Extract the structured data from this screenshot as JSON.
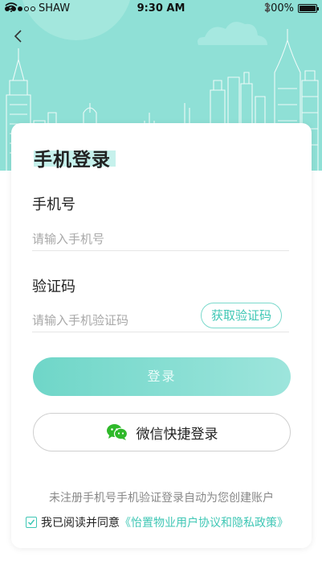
{
  "status_bar": {
    "carrier": "SHAW",
    "time": "9:30 AM",
    "battery": "100%"
  },
  "header": {
    "back_icon": "chevron-left-icon",
    "background_color": "#8fe0d6"
  },
  "form": {
    "title": "手机登录",
    "phone_label": "手机号",
    "phone_placeholder": "请输入手机号",
    "code_label": "验证码",
    "code_placeholder": "请输入手机验证码",
    "get_code_label": "获取验证码"
  },
  "actions": {
    "login_label": "登录",
    "wechat_label": "微信快捷登录",
    "wechat_icon": "wechat-icon"
  },
  "footer": {
    "notice": "未注册手机号手机验证登录自动为您创建账户",
    "agree_prefix": "我已阅读并同意",
    "agree_link": "《怡置物业用户协议和隐私政策》",
    "checkbox_checked": true
  },
  "colors": {
    "accent": "#3fc7b5",
    "hero": "#8fe0d6"
  }
}
